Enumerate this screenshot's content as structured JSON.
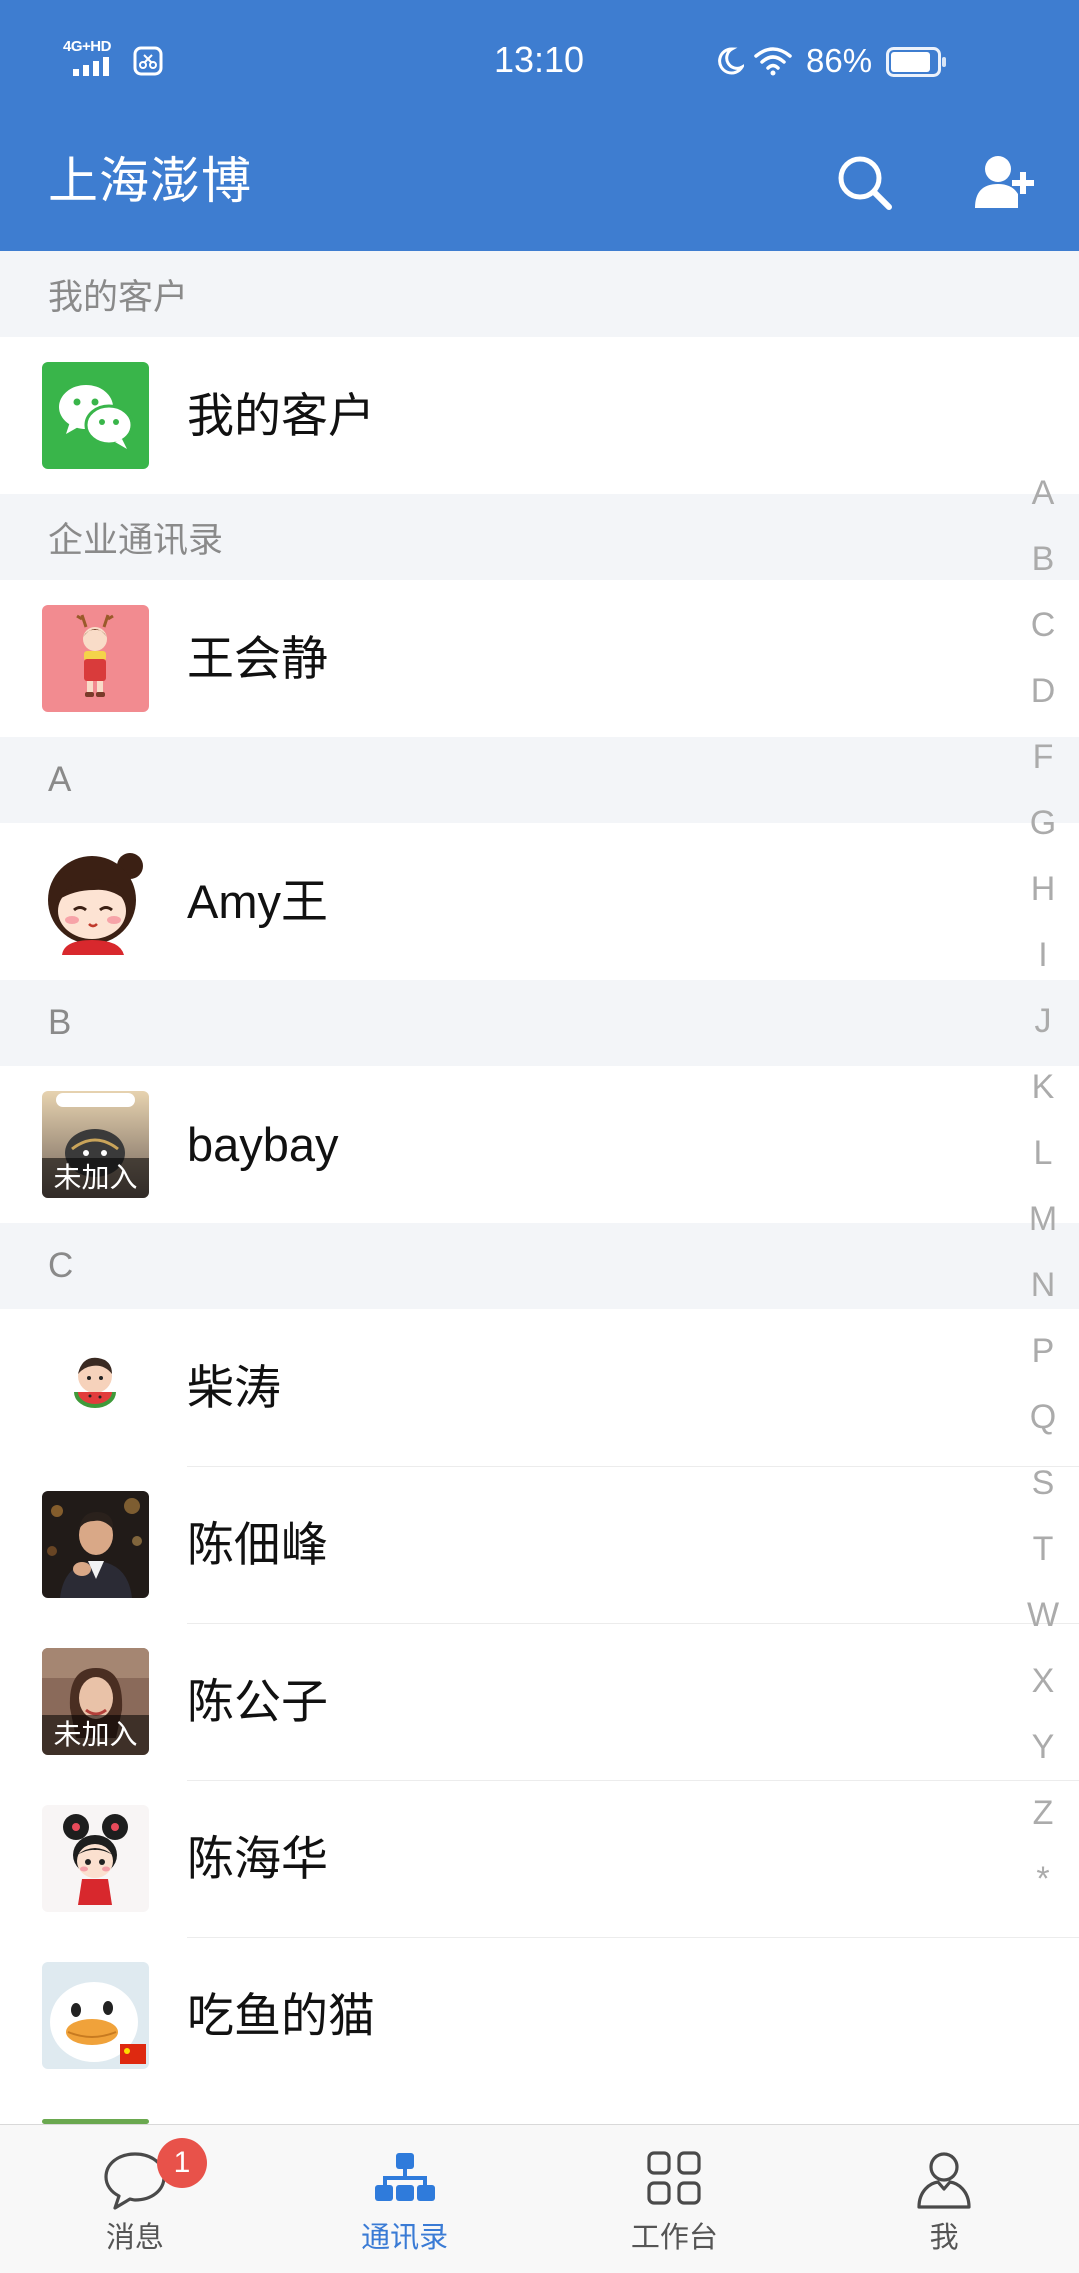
{
  "status_bar": {
    "network": "4G+HD",
    "time": "13:10",
    "battery_percent": "86%"
  },
  "header": {
    "title": "上海澎博",
    "search_icon": "search-icon",
    "add_contact_icon": "add-contact-icon"
  },
  "sections": [
    {
      "title": "我的客户",
      "items": [
        {
          "name": "我的客户",
          "avatar": "wechat-icon"
        }
      ]
    },
    {
      "title": "企业通讯录",
      "items": [
        {
          "name": "王会静"
        }
      ]
    },
    {
      "title": "A",
      "items": [
        {
          "name": "Amy王"
        }
      ]
    },
    {
      "title": "B",
      "items": [
        {
          "name": "baybay",
          "status": "未加入"
        }
      ]
    },
    {
      "title": "C",
      "items": [
        {
          "name": "柴涛"
        },
        {
          "name": "陈佃峰"
        },
        {
          "name": "陈公子",
          "status": "未加入"
        },
        {
          "name": "陈海华"
        },
        {
          "name": "吃鱼的猫"
        }
      ]
    }
  ],
  "index_bar": [
    "A",
    "B",
    "C",
    "D",
    "F",
    "G",
    "H",
    "I",
    "J",
    "K",
    "L",
    "M",
    "N",
    "P",
    "Q",
    "S",
    "T",
    "W",
    "X",
    "Y",
    "Z",
    "*"
  ],
  "tab_bar": {
    "tabs": [
      {
        "label": "消息",
        "icon": "message-icon",
        "badge": "1"
      },
      {
        "label": "通讯录",
        "icon": "contacts-icon",
        "active": true
      },
      {
        "label": "工作台",
        "icon": "workbench-icon"
      },
      {
        "label": "我",
        "icon": "me-icon"
      }
    ]
  },
  "colors": {
    "header": "#3e7dd0",
    "accent": "#3a7bd5",
    "badge": "#e8524a",
    "section_bg": "#f3f5f8",
    "wechat_green": "#39b54a"
  }
}
